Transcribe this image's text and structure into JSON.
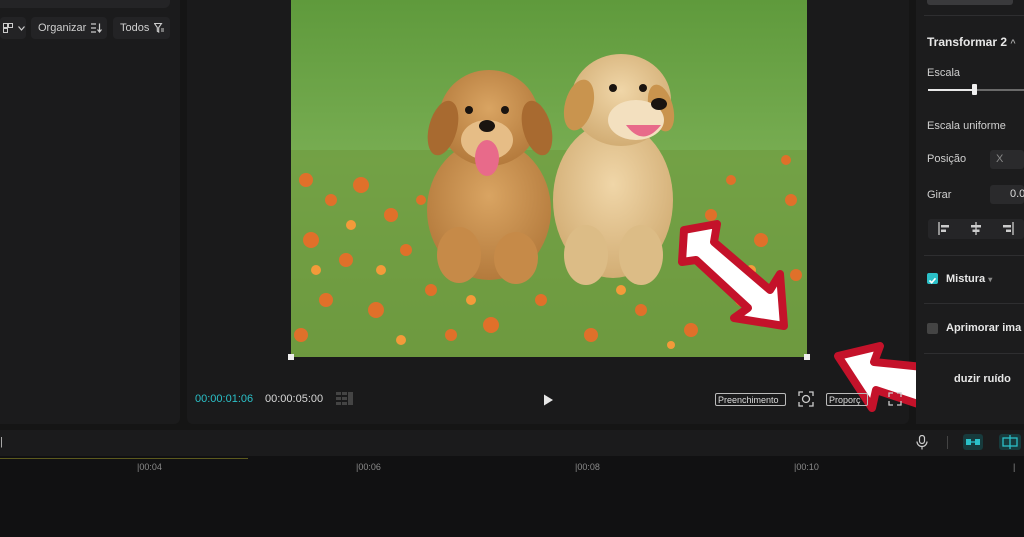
{
  "media_toolbar": {
    "organize_label": "Organizar",
    "filter_label": "Todos"
  },
  "player": {
    "current_time": "00:00:01:06",
    "total_time": "00:00:05:00",
    "fill_label": "Preenchimento",
    "ratio_label": "Proporç"
  },
  "properties": {
    "transform_title": "Transformar 2",
    "scale_label": "Escala",
    "scale_value": 0.7,
    "uniform_scale_label": "Escala uniforme",
    "position_label": "Posição",
    "position_x_label": "X",
    "rotate_label": "Girar",
    "rotate_value": "0.0",
    "blend_label": "Mistura",
    "enhance_label": "Aprimorar ima",
    "noise_label": "duzir ruído"
  },
  "timeline": {
    "ticks": [
      "|00:04",
      "|00:06",
      "|00:08",
      "|00:10"
    ]
  },
  "colors": {
    "accent": "#2bc0c8",
    "arrow": "#c4122a"
  }
}
